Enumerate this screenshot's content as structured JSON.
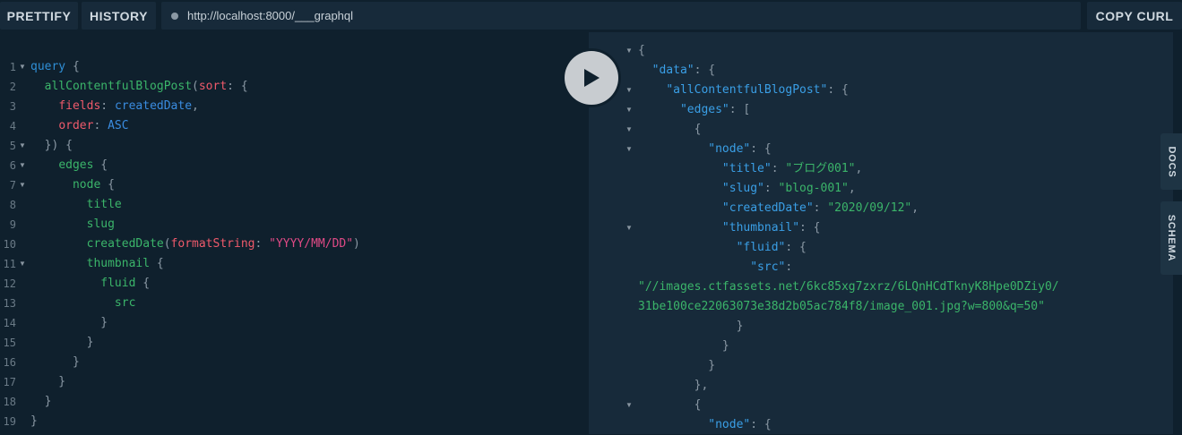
{
  "toolbar": {
    "prettify": "PRETTIFY",
    "history": "HISTORY",
    "url": "http://localhost:8000/___graphql",
    "copy_curl": "COPY CURL"
  },
  "side_tabs": {
    "docs": "DOCS",
    "schema": "SCHEMA"
  },
  "query_lines": [
    {
      "n": "1",
      "fold": true,
      "tokens": [
        [
          "kw",
          "query"
        ],
        [
          "p",
          " {"
        ]
      ]
    },
    {
      "n": "2",
      "fold": false,
      "tokens": [
        [
          "p",
          "  "
        ],
        [
          "fn",
          "allContentfulBlogPost"
        ],
        [
          "p",
          "("
        ],
        [
          "arg",
          "sort"
        ],
        [
          "p",
          ": {"
        ]
      ]
    },
    {
      "n": "3",
      "fold": false,
      "tokens": [
        [
          "p",
          "    "
        ],
        [
          "arg",
          "fields"
        ],
        [
          "p",
          ": "
        ],
        [
          "enum",
          "createdDate"
        ],
        [
          "p",
          ","
        ]
      ]
    },
    {
      "n": "4",
      "fold": false,
      "tokens": [
        [
          "p",
          "    "
        ],
        [
          "arg",
          "order"
        ],
        [
          "p",
          ": "
        ],
        [
          "enum",
          "ASC"
        ]
      ]
    },
    {
      "n": "5",
      "fold": true,
      "tokens": [
        [
          "p",
          "  }) {"
        ]
      ]
    },
    {
      "n": "6",
      "fold": true,
      "tokens": [
        [
          "p",
          "    "
        ],
        [
          "fn",
          "edges"
        ],
        [
          "p",
          " {"
        ]
      ]
    },
    {
      "n": "7",
      "fold": true,
      "tokens": [
        [
          "p",
          "      "
        ],
        [
          "fn",
          "node"
        ],
        [
          "p",
          " {"
        ]
      ]
    },
    {
      "n": "8",
      "fold": false,
      "tokens": [
        [
          "p",
          "        "
        ],
        [
          "fn",
          "title"
        ]
      ]
    },
    {
      "n": "9",
      "fold": false,
      "tokens": [
        [
          "p",
          "        "
        ],
        [
          "fn",
          "slug"
        ]
      ]
    },
    {
      "n": "10",
      "fold": false,
      "tokens": [
        [
          "p",
          "        "
        ],
        [
          "fn",
          "createdDate"
        ],
        [
          "p",
          "("
        ],
        [
          "arg",
          "formatString"
        ],
        [
          "p",
          ": "
        ],
        [
          "str",
          "\"YYYY/MM/DD\""
        ],
        [
          "p",
          ")"
        ]
      ]
    },
    {
      "n": "11",
      "fold": true,
      "tokens": [
        [
          "p",
          "        "
        ],
        [
          "fn",
          "thumbnail"
        ],
        [
          "p",
          " {"
        ]
      ]
    },
    {
      "n": "12",
      "fold": false,
      "tokens": [
        [
          "p",
          "          "
        ],
        [
          "fn",
          "fluid"
        ],
        [
          "p",
          " {"
        ]
      ]
    },
    {
      "n": "13",
      "fold": false,
      "tokens": [
        [
          "p",
          "            "
        ],
        [
          "fn",
          "src"
        ]
      ]
    },
    {
      "n": "14",
      "fold": false,
      "tokens": [
        [
          "p",
          "          }"
        ]
      ]
    },
    {
      "n": "15",
      "fold": false,
      "tokens": [
        [
          "p",
          "        }"
        ]
      ]
    },
    {
      "n": "16",
      "fold": false,
      "tokens": [
        [
          "p",
          "      }"
        ]
      ]
    },
    {
      "n": "17",
      "fold": false,
      "tokens": [
        [
          "p",
          "    }"
        ]
      ]
    },
    {
      "n": "18",
      "fold": false,
      "tokens": [
        [
          "p",
          "  }"
        ]
      ]
    },
    {
      "n": "19",
      "fold": false,
      "tokens": [
        [
          "p",
          "}"
        ]
      ]
    }
  ],
  "result_lines": [
    {
      "fold": true,
      "tokens": [
        [
          "p",
          "{"
        ]
      ]
    },
    {
      "fold": false,
      "tokens": [
        [
          "p",
          "  "
        ],
        [
          "key",
          "\"data\""
        ],
        [
          "p",
          ": {"
        ]
      ]
    },
    {
      "fold": true,
      "tokens": [
        [
          "p",
          "    "
        ],
        [
          "key",
          "\"allContentfulBlogPost\""
        ],
        [
          "p",
          ": {"
        ]
      ]
    },
    {
      "fold": true,
      "tokens": [
        [
          "p",
          "      "
        ],
        [
          "key",
          "\"edges\""
        ],
        [
          "p",
          ": ["
        ]
      ]
    },
    {
      "fold": true,
      "tokens": [
        [
          "p",
          "        {"
        ]
      ]
    },
    {
      "fold": true,
      "tokens": [
        [
          "p",
          "          "
        ],
        [
          "key",
          "\"node\""
        ],
        [
          "p",
          ": {"
        ]
      ]
    },
    {
      "fold": false,
      "tokens": [
        [
          "p",
          "            "
        ],
        [
          "key",
          "\"title\""
        ],
        [
          "p",
          ": "
        ],
        [
          "jstr",
          "\"ブログ001\""
        ],
        [
          "p",
          ","
        ]
      ]
    },
    {
      "fold": false,
      "tokens": [
        [
          "p",
          "            "
        ],
        [
          "key",
          "\"slug\""
        ],
        [
          "p",
          ": "
        ],
        [
          "jstr",
          "\"blog-001\""
        ],
        [
          "p",
          ","
        ]
      ]
    },
    {
      "fold": false,
      "tokens": [
        [
          "p",
          "            "
        ],
        [
          "key",
          "\"createdDate\""
        ],
        [
          "p",
          ": "
        ],
        [
          "jstr",
          "\"2020/09/12\""
        ],
        [
          "p",
          ","
        ]
      ]
    },
    {
      "fold": true,
      "tokens": [
        [
          "p",
          "            "
        ],
        [
          "key",
          "\"thumbnail\""
        ],
        [
          "p",
          ": {"
        ]
      ]
    },
    {
      "fold": false,
      "tokens": [
        [
          "p",
          "              "
        ],
        [
          "key",
          "\"fluid\""
        ],
        [
          "p",
          ": {"
        ]
      ]
    },
    {
      "fold": false,
      "tokens": [
        [
          "p",
          "                "
        ],
        [
          "key",
          "\"src\""
        ],
        [
          "p",
          ":"
        ]
      ]
    },
    {
      "fold": false,
      "tokens": [
        [
          "jstr",
          "\"//images.ctfassets.net/6kc85xg7zxrz/6LQnHCdTknyK8Hpe0DZiy0/"
        ]
      ]
    },
    {
      "fold": false,
      "tokens": [
        [
          "jstr",
          "31be100ce22063073e38d2b05ac784f8/image_001.jpg?w=800&q=50\""
        ]
      ]
    },
    {
      "fold": false,
      "tokens": [
        [
          "p",
          "              }"
        ]
      ]
    },
    {
      "fold": false,
      "tokens": [
        [
          "p",
          "            }"
        ]
      ]
    },
    {
      "fold": false,
      "tokens": [
        [
          "p",
          "          }"
        ]
      ]
    },
    {
      "fold": false,
      "tokens": [
        [
          "p",
          "        },"
        ]
      ]
    },
    {
      "fold": true,
      "tokens": [
        [
          "p",
          "        {"
        ]
      ]
    },
    {
      "fold": false,
      "tokens": [
        [
          "p",
          "          "
        ],
        [
          "key",
          "\"node\""
        ],
        [
          "p",
          ": {"
        ]
      ]
    }
  ],
  "colors": {
    "background": "#0f202d",
    "result_background": "#172a3a",
    "keyword": "#2f8fd6",
    "field": "#3bb56a",
    "argument": "#ef5a6b",
    "string": "#e04a86"
  },
  "icons": {
    "run": "play-icon",
    "url_status": "dot-icon",
    "fold": "triangle-down-icon"
  }
}
